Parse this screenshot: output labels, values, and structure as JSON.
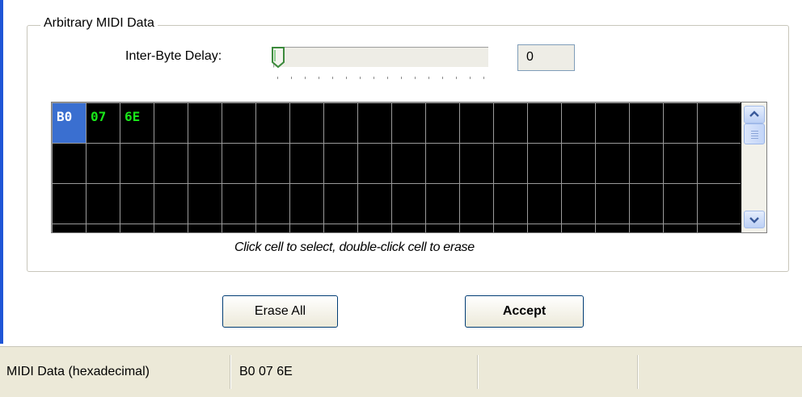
{
  "group": {
    "title": "Arbitrary MIDI Data"
  },
  "delay": {
    "label": "Inter-Byte Delay:",
    "slider_value": 0,
    "value": "0"
  },
  "grid": {
    "columns": 19,
    "rows": 3,
    "bytes": [
      "B0",
      "07",
      "6E"
    ],
    "selected_index": 0
  },
  "hint": "Click cell to select, double-click cell to erase",
  "buttons": {
    "erase_all": "Erase All",
    "accept": "Accept"
  },
  "status": {
    "label": "MIDI Data (hexadecimal)",
    "value": "B0 07 6E",
    "panel3": "",
    "panel4": ""
  },
  "colors": {
    "accent": "#1f55d6",
    "byte_text": "#19e619",
    "selected_cell": "#3a6fd0"
  }
}
